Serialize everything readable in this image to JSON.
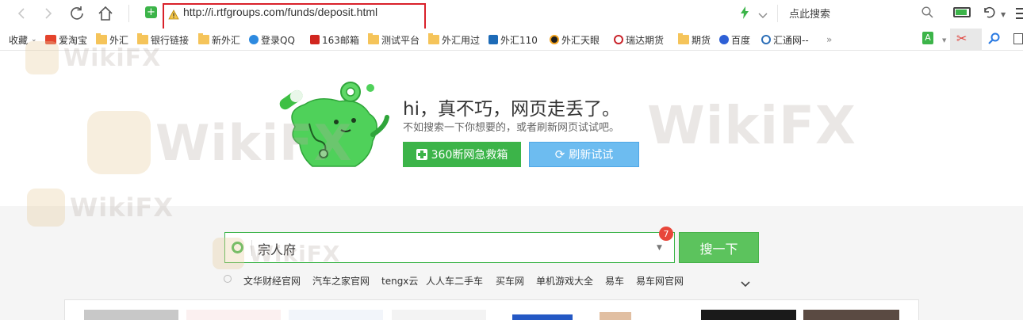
{
  "browser": {
    "url": "http://i.rtfgroups.com/funds/deposit.html",
    "search_placeholder": "点此搜索"
  },
  "bookmarks": [
    {
      "label": "收藏",
      "icon": "star-icon"
    },
    {
      "label": "爱淘宝",
      "icon": "taobao-icon"
    },
    {
      "label": "外汇",
      "icon": "folder-icon"
    },
    {
      "label": "银行链接",
      "icon": "folder-icon"
    },
    {
      "label": "新外汇",
      "icon": "folder-icon"
    },
    {
      "label": "登录QQ",
      "icon": "qq-icon"
    },
    {
      "label": "163邮箱",
      "icon": "mail-icon"
    },
    {
      "label": "测试平台",
      "icon": "folder-icon"
    },
    {
      "label": "外汇用过",
      "icon": "folder-icon"
    },
    {
      "label": "外汇110",
      "icon": "forex110-icon"
    },
    {
      "label": "外汇天眼",
      "icon": "skyeye-icon"
    },
    {
      "label": "瑞达期货",
      "icon": "ruida-icon"
    },
    {
      "label": "期货",
      "icon": "folder-icon"
    },
    {
      "label": "百度",
      "icon": "baidu-icon"
    },
    {
      "label": "汇通网--",
      "icon": "huitong-icon"
    }
  ],
  "error": {
    "title": "hi，真不巧，网页走丢了。",
    "subtitle": "不如搜索一下你想要的，或者刷新网页试试吧。",
    "btn_first_aid": "360断网急救箱",
    "btn_refresh": "刷新试试"
  },
  "search": {
    "value": "宗人府",
    "button": "搜一下",
    "badge": "7",
    "hot_links": [
      "文华财经官网",
      "汽车之家官网",
      "tengx云",
      "人人车二手车",
      "买车网",
      "单机游戏大全",
      "易车",
      "易车网官网"
    ]
  },
  "watermark": "WikiFX",
  "colors": {
    "green": "#3cb449",
    "blue_button": "#6dbcf0",
    "highlight_red": "#d9212a",
    "badge_red": "#e8463a"
  }
}
